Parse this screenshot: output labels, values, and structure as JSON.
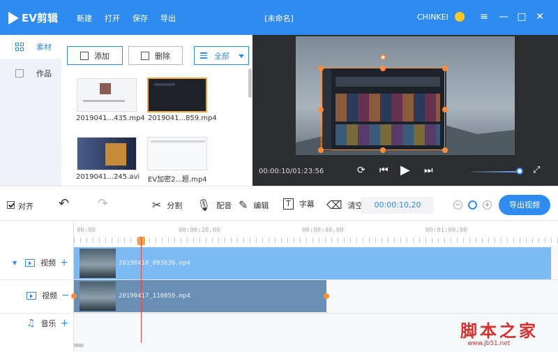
{
  "app": {
    "logo_text": "EV剪辑",
    "document_title": "[未命名]",
    "username": "CHINKEI"
  },
  "menu": [
    "新建",
    "打开",
    "保存",
    "导出"
  ],
  "window_controls": [
    "menu-icon",
    "minimize-icon",
    "maximize-icon",
    "close-icon"
  ],
  "left_nav": [
    {
      "label": "素材",
      "active": true
    },
    {
      "label": "作品",
      "active": false
    }
  ],
  "media_toolbar": {
    "add_label": "添加",
    "delete_label": "删除",
    "filter_label": "全部"
  },
  "media_items": [
    {
      "name": "2019041...435.mp4",
      "selected": false
    },
    {
      "name": "2019041...859.mp4",
      "selected": true
    },
    {
      "name": "2019041...245.avi",
      "selected": false
    },
    {
      "name": "EV加密2...题.mp4",
      "selected": false
    }
  ],
  "player": {
    "time": "00:00:10/01:23:56",
    "volume_percent": 90
  },
  "tools": {
    "align_label": "对齐",
    "split_label": "分割",
    "dub_label": "配音",
    "edit_label": "编辑",
    "subtitle_label": "字幕",
    "clear_label": "清空",
    "timecode": "00:00:10,20",
    "export_label": "导出视频"
  },
  "ruler": [
    "00:00",
    "00:00:20,00",
    "00:00:40,00",
    "00:01:00,00"
  ],
  "tracks": [
    {
      "label": "视频",
      "action": "+"
    },
    {
      "label": "视频",
      "action": "−"
    },
    {
      "label": "音乐",
      "action": "+"
    }
  ],
  "clips": [
    {
      "name": "20190418_093636.mp4",
      "color": "#7db9f2"
    },
    {
      "name": "20190417_110859.mp4",
      "color": "#6a8fb5"
    }
  ],
  "watermark": {
    "title": "脚本之家",
    "url": "www.jb51.net"
  },
  "colors": {
    "accent": "#2e8cf0",
    "handle": "#ff8c3a",
    "playhead": "#e54848"
  }
}
